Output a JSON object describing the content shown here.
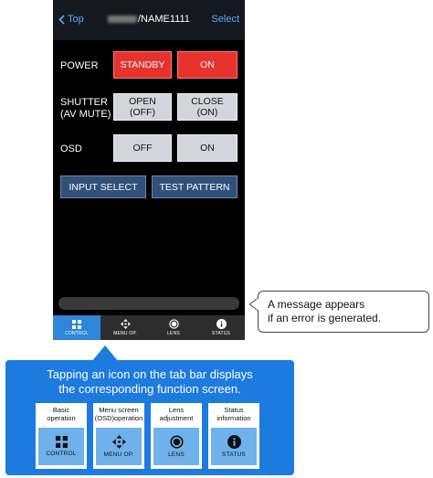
{
  "nav": {
    "back_label": "Top",
    "title": "/NAME1111",
    "select_label": "Select"
  },
  "rows": {
    "power": {
      "label": "POWER",
      "standby": "STANDBY",
      "on": "ON"
    },
    "shutter": {
      "label": "SHUTTER\n(AV MUTE)",
      "open": "OPEN\n(OFF)",
      "close": "CLOSE\n(ON)"
    },
    "osd": {
      "label": "OSD",
      "off": "OFF",
      "on": "ON"
    }
  },
  "buttons": {
    "input_select": "INPUT SELECT",
    "test_pattern": "TEST PATTERN"
  },
  "tabs": [
    {
      "label": "CONTROL",
      "icon": "grid-icon",
      "active": true
    },
    {
      "label": "MENU OP.",
      "icon": "move-arrows-icon",
      "active": false
    },
    {
      "label": "LENS",
      "icon": "lens-icon",
      "active": false
    },
    {
      "label": "STATUS",
      "icon": "info-icon",
      "active": false
    }
  ],
  "callout": {
    "line1": "A message appears",
    "line2": "if an error is generated."
  },
  "info": {
    "title_line1": "Tapping an icon on the tab bar displays",
    "title_line2": "the corresponding function screen.",
    "cards": [
      {
        "label": "Basic\noperation",
        "icon_label": "CONTROL",
        "icon": "grid-icon"
      },
      {
        "label": "Menu screen\n(OSD)operation",
        "icon_label": "MENU OP.",
        "icon": "move-arrows-icon"
      },
      {
        "label": "Lens\nadjustment",
        "icon_label": "LENS",
        "icon": "lens-icon"
      },
      {
        "label": "Status\ninformation",
        "icon_label": "STATUS",
        "icon": "info-icon"
      }
    ]
  },
  "colors": {
    "active_red": "#e8322e",
    "tab_active": "#2d86d8",
    "panel_blue": "#1d7be0",
    "link_blue": "#5aa9ff"
  }
}
